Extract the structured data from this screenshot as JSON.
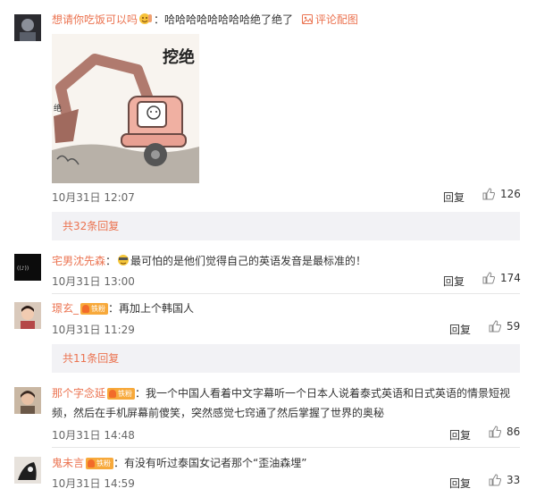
{
  "comments": [
    {
      "user": "想请你吃饭可以吗",
      "text": "哈哈哈哈哈哈哈哈绝了绝了",
      "pic_link": "评论配图",
      "meme_text": "挖绝",
      "time": "10月31日 12:07",
      "reply": "回复",
      "likes": "126"
    },
    {
      "user": "宅男沈先森",
      "text": "最可怕的是他们觉得自己的英语发音是最标准的！",
      "time": "10月31日 13:00",
      "reply": "回复",
      "likes": "174"
    },
    {
      "user": "璟玄_",
      "badge": "铁粉",
      "text": "再加上个韩国人",
      "time": "10月31日 11:29",
      "reply": "回复",
      "likes": "59"
    },
    {
      "user": "那个字念延",
      "badge": "铁粉",
      "text_line1": "我一个中国人看着中文字幕听一个日本人说着泰式英语和日式英语的情景短视",
      "text_line2": "频，然后在手机屏幕前傻笑，突然感觉七窍通了然后掌握了世界的奥秘",
      "time": "10月31日 14:48",
      "reply": "回复",
      "likes": "86"
    },
    {
      "user": "鬼未言",
      "badge": "铁粉",
      "text": "有没有听过泰国女记者那个“歪油森埋”",
      "time": "10月31日 14:59",
      "reply": "回复",
      "likes": "33"
    }
  ],
  "more_replies": [
    "共32条回复",
    "共11条回复"
  ],
  "colon": "：",
  "colors": {
    "username": "#eb7350",
    "panel": "#f2f2f5",
    "badge": "#f7a93b"
  },
  "icons": [
    "avatar",
    "emoji-icon",
    "image-icon",
    "fan-badge-icon",
    "thumb-up-icon"
  ]
}
